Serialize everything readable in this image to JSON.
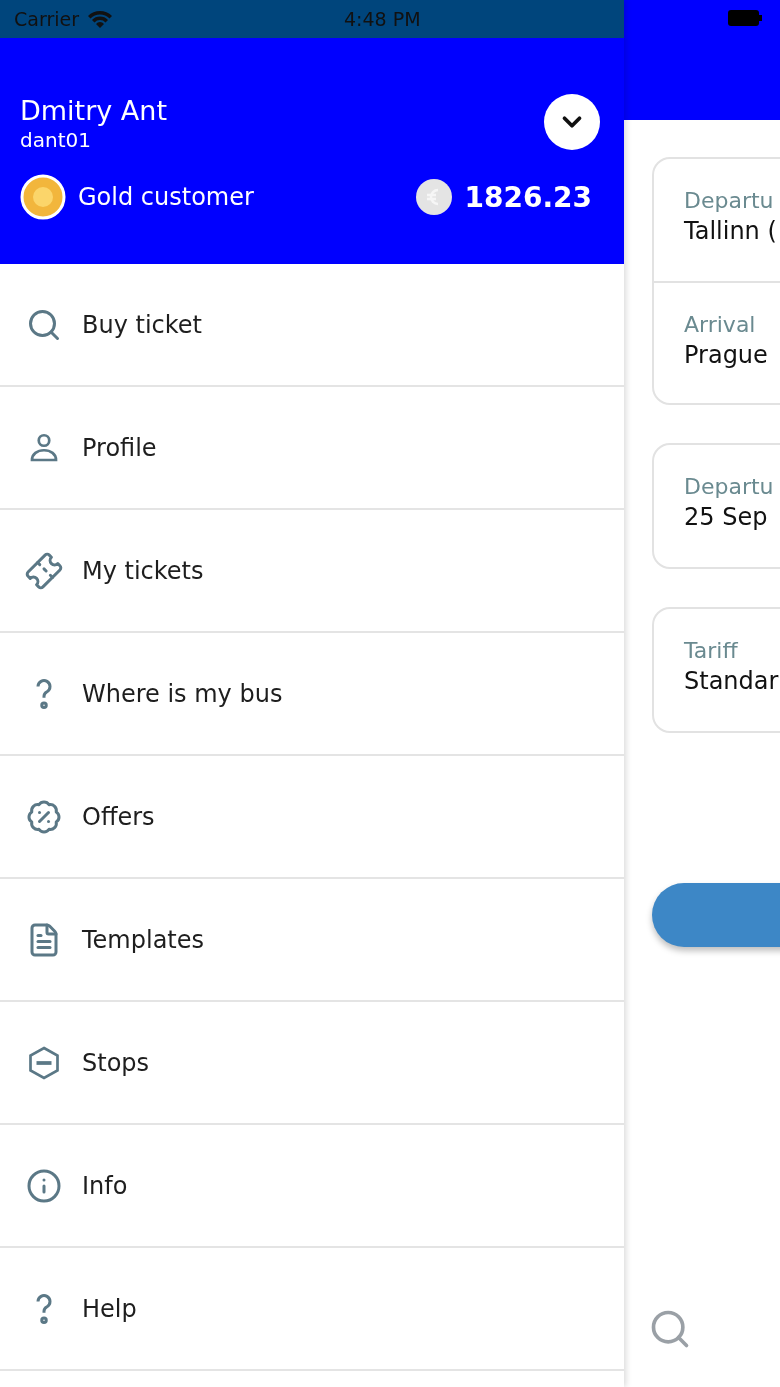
{
  "status_bar": {
    "carrier": "Carrier",
    "time": "4:48 PM"
  },
  "user": {
    "name": "Dmitry Ant",
    "username": "dant01",
    "tier": "Gold customer",
    "balance": "1826.23"
  },
  "menu": [
    {
      "label": "Buy ticket"
    },
    {
      "label": "Profile"
    },
    {
      "label": "My tickets"
    },
    {
      "label": "Where is my bus"
    },
    {
      "label": "Offers"
    },
    {
      "label": "Templates"
    },
    {
      "label": "Stops"
    },
    {
      "label": "Info"
    },
    {
      "label": "Help"
    }
  ],
  "background_screen": {
    "cards": [
      {
        "fields": [
          {
            "label": "Departu",
            "value": "Tallinn ("
          },
          {
            "label": "Arrival",
            "value": "Prague"
          }
        ]
      },
      {
        "fields": [
          {
            "label": "Departu",
            "value": "25 Sep"
          }
        ]
      },
      {
        "fields": [
          {
            "label": "Tariff",
            "value": "Standar"
          }
        ]
      }
    ]
  }
}
